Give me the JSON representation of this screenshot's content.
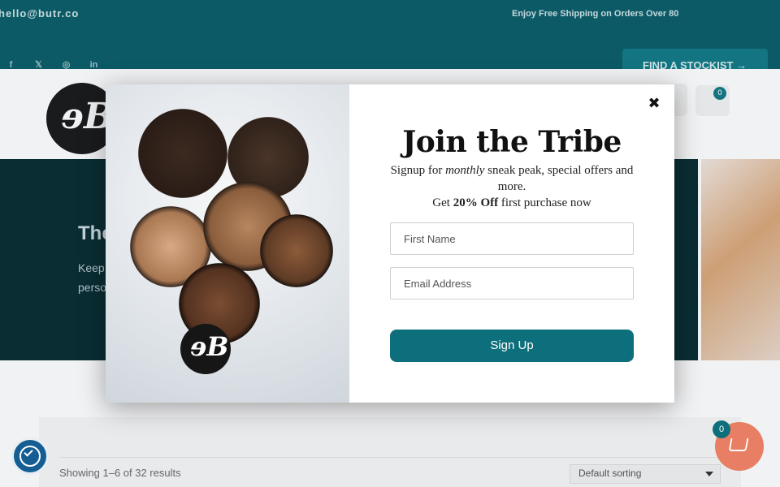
{
  "topbar": {
    "email": "hello@butr.co",
    "shipping": "Enjoy Free Shipping on Orders Over 80",
    "stockist_button": "FIND A STOCKIST →",
    "social_icons": [
      "facebook-icon",
      "x-icon",
      "instagram-icon",
      "linkedin-icon"
    ],
    "social_glyphs": [
      "f",
      "𝕏",
      "◎",
      "in"
    ]
  },
  "header": {
    "logo_text": "ɘB",
    "cart_count": "0"
  },
  "hero": {
    "title": "The",
    "text": "Keep perso"
  },
  "shop": {
    "results": "Showing 1–6 of 32 results",
    "sorting": "Default sorting"
  },
  "modal": {
    "title": "Join the Tribe",
    "subtitle_part1": "Signup for ",
    "subtitle_italic": "monthly",
    "subtitle_part2": " sneak peak, special offers and more.",
    "subtitle_part3": "Get ",
    "subtitle_bold": "20% Off",
    "subtitle_part4": " first purchase now",
    "first_name_placeholder": "First Name",
    "email_placeholder": "Email Address",
    "signup_label": "Sign Up",
    "close_symbol": "✖",
    "logo_text": "ɘB"
  },
  "widgets": {
    "cart_fab_count": "0"
  },
  "colors": {
    "topbar": "#0c5e6a",
    "accent": "#0e6f7c",
    "hero": "#0a2e35",
    "cart_fab": "#e87e63",
    "accessibility": "#155e93"
  }
}
